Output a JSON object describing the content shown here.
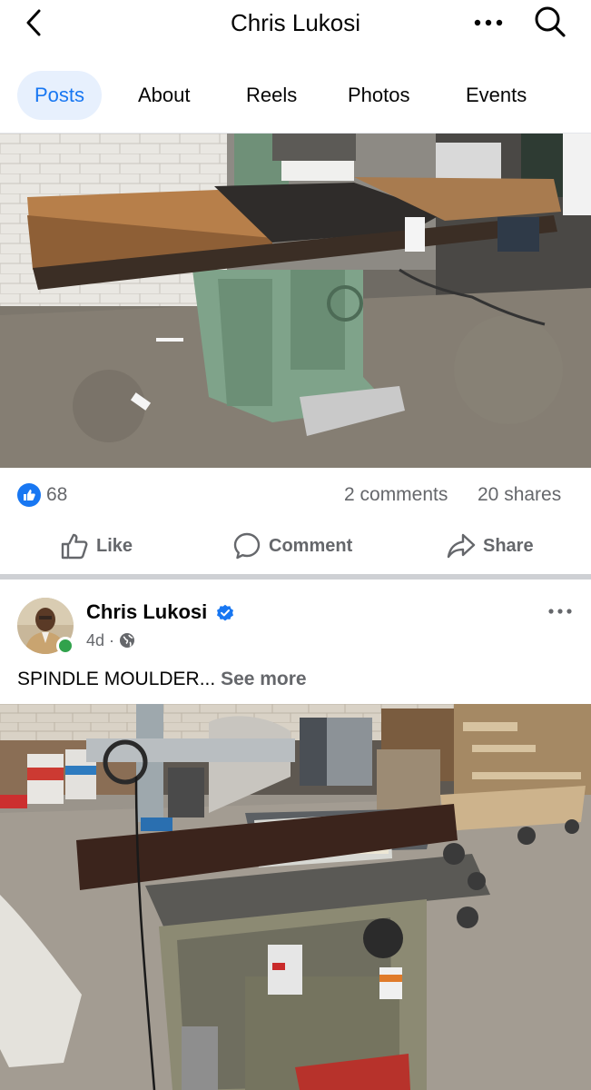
{
  "header": {
    "title": "Chris Lukosi",
    "back_icon": "chevron-left-icon",
    "more_icon": "more-horizontal-icon",
    "search_icon": "search-icon"
  },
  "tabs": [
    {
      "label": "Posts",
      "active": true
    },
    {
      "label": "About",
      "active": false
    },
    {
      "label": "Reels",
      "active": false
    },
    {
      "label": "Photos",
      "active": false
    },
    {
      "label": "Events",
      "active": false
    }
  ],
  "posts": [
    {
      "image": "photo of an industrial spindle moulder machine with extended wooden tables",
      "reactions": {
        "count": "68",
        "icon": "like-icon"
      },
      "comments_label": "2 comments",
      "shares_label": "20 shares",
      "actions": {
        "like": "Like",
        "comment": "Comment",
        "share": "Share"
      }
    },
    {
      "author": {
        "name": "Chris Lukosi",
        "verified": true,
        "online": true
      },
      "time": "4d",
      "separator": "·",
      "audience_icon": "globe-icon",
      "text": "SPINDLE MOULDER...",
      "see_more_label": "See more",
      "image": "photo of a spindle moulder with power feeder in a workshop"
    }
  ],
  "colors": {
    "accent": "#1877f2",
    "active_tab_bg": "#e7f0fd",
    "secondary_text": "#65676b",
    "online": "#31a24c"
  }
}
